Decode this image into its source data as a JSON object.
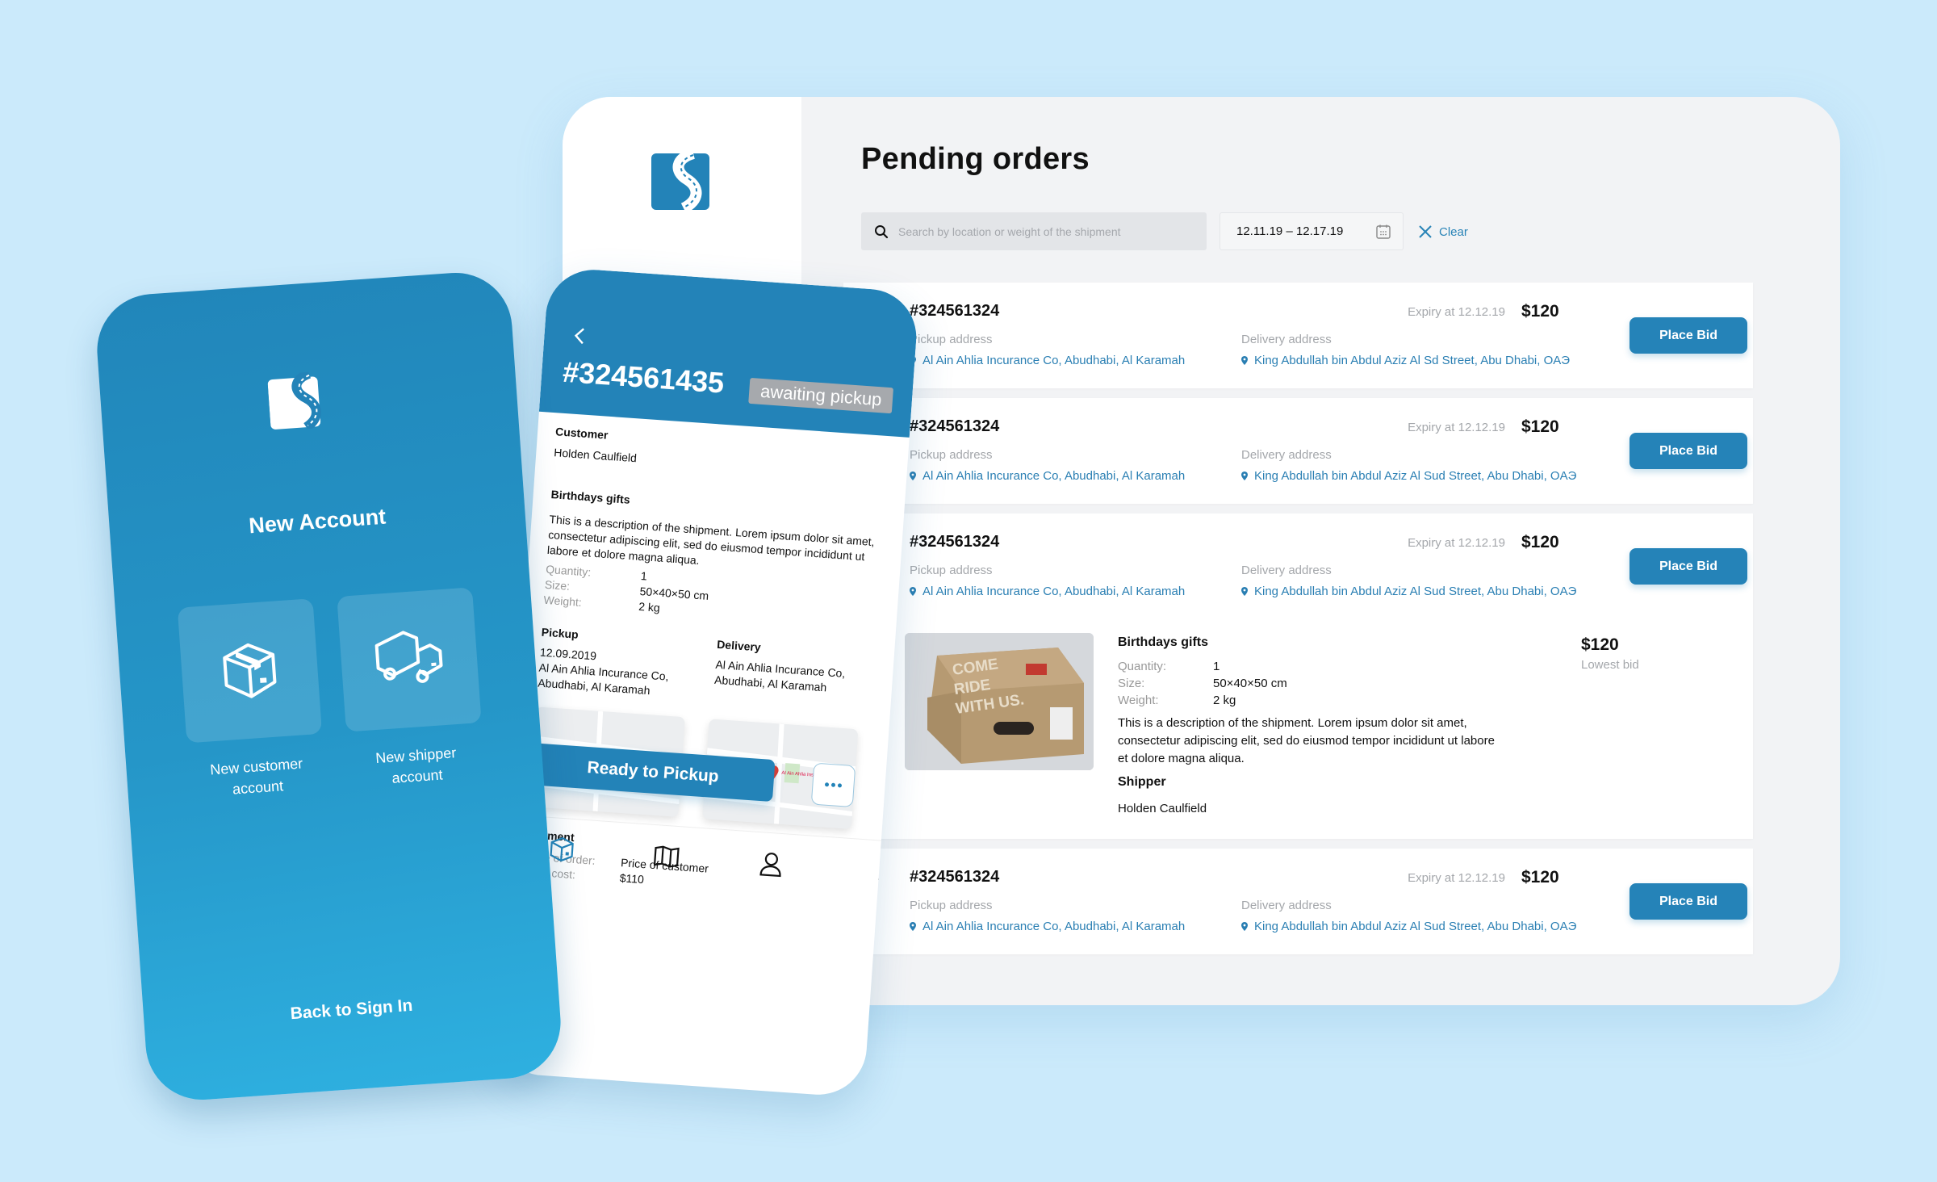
{
  "desktop": {
    "page_title": "Pending orders",
    "search": {
      "placeholder": "Search by location or weight of the shipment",
      "value": ""
    },
    "date_range": "12.11.19 – 12.17.19",
    "clear_label": "Clear",
    "labels": {
      "pickup": "Pickup address",
      "delivery": "Delivery address",
      "place_bid": "Place Bid"
    },
    "orders": [
      {
        "id": "#324561324",
        "expiry": "Expiry at 12.12.19",
        "price": "$120",
        "pickup": "Al Ain Ahlia Incurance Co, Abudhabi, Al Karamah",
        "delivery": "King Abdullah bin Abdul Aziz Al Sd Street, Abu Dhabi, OAЭ"
      },
      {
        "id": "#324561324",
        "expiry": "Expiry at 12.12.19",
        "price": "$120",
        "pickup": "Al Ain Ahlia Incurance Co, Abudhabi, Al Karamah",
        "delivery": "King Abdullah bin Abdul Aziz Al Sud Street, Abu Dhabi, OAЭ"
      },
      {
        "id": "#324561324",
        "expiry": "Expiry at 12.12.19",
        "price": "$120",
        "pickup": "Al Ain Ahlia Incurance Co, Abudhabi, Al Karamah",
        "delivery": "King Abdullah bin Abdul Aziz Al Sud Street, Abu Dhabi, OAЭ",
        "expanded": true,
        "detail": {
          "title": "Birthdays gifts",
          "quantity_label": "Quantity:",
          "quantity": "1",
          "size_label": "Size:",
          "size": "50×40×50 cm",
          "weight_label": "Weight:",
          "weight": "2 kg",
          "description": "This is a description of the shipment. Lorem ipsum dolor sit amet, consectetur adipiscing elit, sed do eiusmod tempor incididunt ut labore et dolore magna aliqua.",
          "shipper_label": "Shipper",
          "shipper": "Holden Caulfield",
          "lowest_bid": "$120",
          "lowest_bid_label": "Lowest bid",
          "image_text": [
            "COME",
            "RIDE",
            "WITH US."
          ]
        }
      },
      {
        "id": "#324561324",
        "expiry": "Expiry at 12.12.19",
        "price": "$120",
        "pickup": "Al Ain Ahlia Incurance Co, Abudhabi, Al Karamah",
        "delivery": "King Abdullah bin Abdul Aziz Al Sud Street, Abu Dhabi, OAЭ"
      }
    ]
  },
  "new_account": {
    "title": "New Account",
    "customer_label_1": "New customer",
    "customer_label_2": "account",
    "shipper_label_1": "New shipper",
    "shipper_label_2": "account",
    "back_label": "Back to Sign In"
  },
  "order_detail": {
    "id": "#324561435",
    "status": "awaiting pickup",
    "customer_label": "Customer",
    "customer": "Holden Caulfield",
    "title": "Birthdays gifts",
    "description": "This is a description of the shipment. Lorem ipsum dolor sit amet, consectetur adipiscing elit, sed do eiusmod tempor incididunt ut labore et dolore magna aliqua.",
    "quantity_label": "Quantity:",
    "quantity": "1",
    "size_label": "Size:",
    "size": "50×40×50 cm",
    "weight_label": "Weight:",
    "weight": "2 kg",
    "pickup_label": "Pickup",
    "pickup_date": "12.09.2019",
    "pickup_address": "Al Ain Ahlia Incurance Co, Abudhabi, Al Karamah",
    "delivery_label": "Delivery",
    "delivery_address": "Al Ain Ahlia Incurance Co, Abudhabi, Al Karamah",
    "map_pin_label": "Al Ain Ahlia Insurance",
    "payment_label": "Payment",
    "order_type_label": "Type of order:",
    "order_type": "Price of customer",
    "cost_label": "Total cost:",
    "cost": "$110",
    "ready_label": "Ready to Pickup",
    "nav": [
      "orders",
      "map",
      "profile"
    ]
  },
  "colors": {
    "accent": "#2383b8",
    "link": "#2a7fb3",
    "background": "#cbeafb",
    "badge": "#a6a9ad"
  }
}
